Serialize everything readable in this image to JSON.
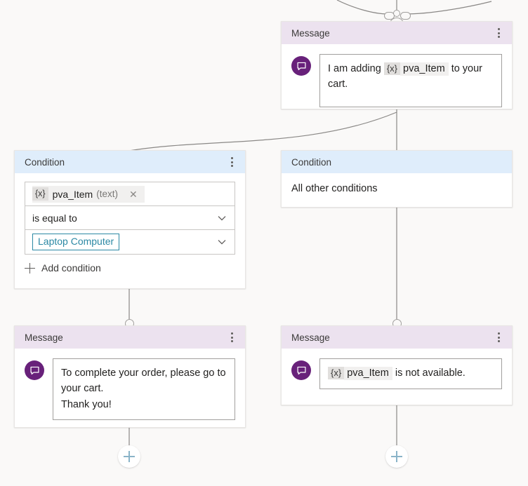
{
  "canvas": {
    "background_color": "#faf9f8",
    "connector_color": "#8a8886"
  },
  "nodes": {
    "top_message": {
      "header_title": "Message",
      "header_color": "#ece2ef",
      "menu_icon": "kebab-menu-icon",
      "avatar_icon": "message-bubble-icon",
      "avatar_color": "#68217a",
      "text_prefix": "I am adding",
      "variable_prefix": "{x}",
      "variable_name": "pva_Item",
      "text_suffix": "to your cart."
    },
    "left_condition": {
      "header_title": "Condition",
      "header_color": "#dfedfb",
      "menu_icon": "kebab-menu-icon",
      "variable_prefix": "{x}",
      "variable_name": "pva_Item",
      "variable_type": "(text)",
      "remove_icon": "close-icon",
      "operator": "is equal to",
      "operator_chevron": "chevron-down-icon",
      "value": "Laptop Computer",
      "value_chevron": "chevron-down-icon",
      "add_condition_label": "Add condition",
      "add_condition_icon": "plus-icon",
      "value_accent_color": "#2b88a4"
    },
    "right_condition": {
      "header_title": "Condition",
      "header_color": "#dfedfb",
      "body_text": "All other conditions"
    },
    "left_message": {
      "header_title": "Message",
      "header_color": "#ece2ef",
      "menu_icon": "kebab-menu-icon",
      "avatar_icon": "message-bubble-icon",
      "avatar_color": "#68217a",
      "line_1": "To complete your order, please go to your cart.",
      "line_2": "Thank you!"
    },
    "right_message": {
      "header_title": "Message",
      "header_color": "#ece2ef",
      "menu_icon": "kebab-menu-icon",
      "avatar_icon": "message-bubble-icon",
      "avatar_color": "#68217a",
      "variable_prefix": "{x}",
      "variable_name": "pva_Item",
      "text_suffix": "is not available."
    }
  },
  "add_buttons": {
    "left_label": "+",
    "right_label": "+",
    "accent_color": "#8ab4c8",
    "icon": "plus-icon"
  }
}
